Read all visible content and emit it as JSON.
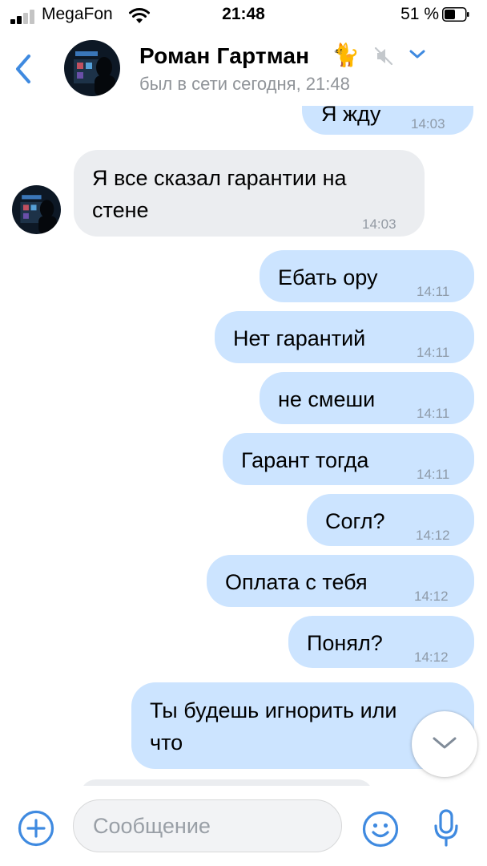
{
  "status_bar": {
    "carrier": "MegaFon",
    "time": "21:48",
    "battery_percent": "51 %"
  },
  "header": {
    "name": "Роман Гартман",
    "name_emoji": "🐈",
    "last_seen": "был в сети сегодня, 21:48"
  },
  "messages": [
    {
      "direction": "out",
      "text": "Я жду",
      "time": "14:03"
    },
    {
      "direction": "in",
      "text": "Я все сказал гарантии на стене",
      "line1": "Я все сказал гарантии на",
      "line2": "стене",
      "time": "14:03"
    },
    {
      "direction": "out",
      "text": "Ебать ору",
      "time": "14:11"
    },
    {
      "direction": "out",
      "text": "Нет гарантий",
      "time": "14:11"
    },
    {
      "direction": "out",
      "text": "не смеши",
      "time": "14:11"
    },
    {
      "direction": "out",
      "text": "Гарант тогда",
      "time": "14:11"
    },
    {
      "direction": "out",
      "text": "Согл?",
      "time": "14:12"
    },
    {
      "direction": "out",
      "text": "Оплата с тебя",
      "time": "14:12"
    },
    {
      "direction": "out",
      "text": "Понял?",
      "time": "14:12"
    },
    {
      "direction": "out",
      "text": "Ты будешь игнорить или что",
      "line1": "Ты будешь игнорить или",
      "line2": "что"
    }
  ],
  "composer": {
    "placeholder": "Сообщение"
  },
  "colors": {
    "accent": "#3f8ae0",
    "outgoing_bubble": "#cce4ff",
    "incoming_bubble": "#ebedf0",
    "secondary_text": "#909499"
  },
  "icons": [
    "signal-icon",
    "wifi-icon",
    "battery-icon",
    "back-icon",
    "cat-emoji",
    "mute-icon",
    "chevron-down-icon",
    "scroll-down-icon",
    "add-icon",
    "emoji-icon",
    "microphone-icon"
  ]
}
